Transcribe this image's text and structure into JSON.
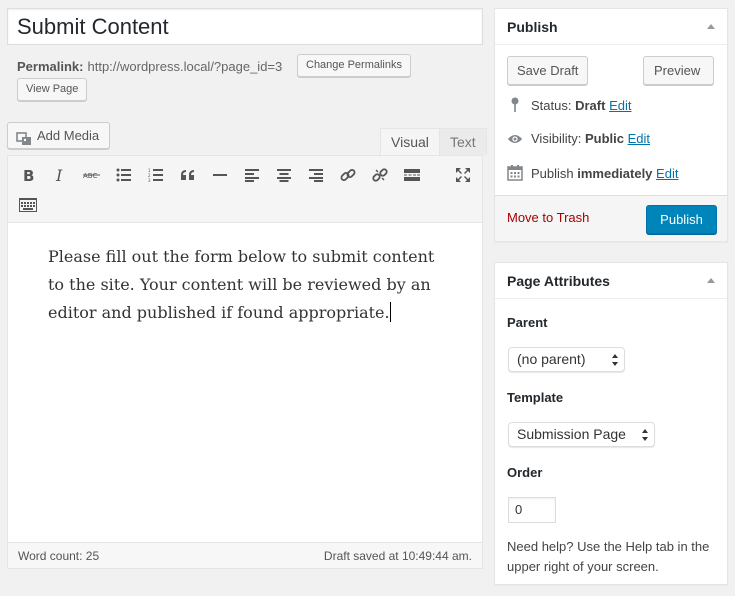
{
  "post": {
    "title": "Submit Content",
    "permalink_label": "Permalink:",
    "permalink_url": "http://wordpress.local/?page_id=3",
    "change_permalinks": "Change Permalinks",
    "view_page": "View Page"
  },
  "editor": {
    "add_media": "Add Media",
    "tabs": {
      "visual": "Visual",
      "text": "Text"
    },
    "toolbar": [
      "bold-icon",
      "italic-icon",
      "strikethrough-icon",
      "bullet-list-icon",
      "numbered-list-icon",
      "blockquote-icon",
      "horizontal-rule-icon",
      "align-left-icon",
      "align-center-icon",
      "align-right-icon",
      "link-icon",
      "unlink-icon",
      "read-more-icon",
      "fullscreen-icon",
      "toolbar-toggle-icon"
    ],
    "content": "Please fill out the form below to submit content to the site. Your content will be reviewed by an editor and published if found appropriate.",
    "word_count": "Word count: 25",
    "draft_saved": "Draft saved at 10:49:44 am."
  },
  "publish": {
    "title": "Publish",
    "save_draft": "Save Draft",
    "preview": "Preview",
    "status_label": "Status:",
    "status_value": "Draft",
    "visibility_label": "Visibility:",
    "visibility_value": "Public",
    "publish_label": "Publish",
    "publish_value": "immediately",
    "edit": "Edit",
    "move_to_trash": "Move to Trash",
    "publish_button": "Publish"
  },
  "attributes": {
    "title": "Page Attributes",
    "parent_label": "Parent",
    "parent_value": "(no parent)",
    "template_label": "Template",
    "template_value": "Submission Page",
    "order_label": "Order",
    "order_value": "0",
    "help": "Need help? Use the Help tab in the upper  right of your screen."
  },
  "colors": {
    "primary_button": "#0085ba",
    "link": "#0073aa",
    "trash": "#aa0000",
    "background": "#f1f1f1"
  }
}
